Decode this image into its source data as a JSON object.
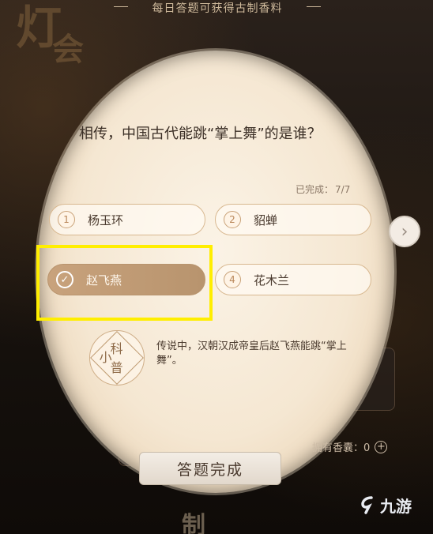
{
  "banner": "每日答题可获得古制香料",
  "bg_glyphs": {
    "left_big": "灯",
    "left_small": "会",
    "bottom": "制"
  },
  "question": "相传，中国古代能跳“掌上舞”的是谁？",
  "progress": {
    "label": "已完成：",
    "value": "7/7"
  },
  "options": [
    {
      "num": "1",
      "text": "杨玉环",
      "selected": false
    },
    {
      "num": "2",
      "text": "貂蝉",
      "selected": false
    },
    {
      "num": "✓",
      "text": "赵飞燕",
      "selected": true
    },
    {
      "num": "4",
      "text": "花木兰",
      "selected": false
    }
  ],
  "science_seal": {
    "top": "科",
    "left": "小",
    "bottom": "普"
  },
  "explanation": "传说中，汉朝汉成帝皇后赵飞燕能跳“掌上舞”。",
  "sachet": {
    "label": "拥有香囊：0"
  },
  "done_button": "答题完成",
  "watermark": "九游",
  "colors": {
    "accent": "#b8946e",
    "highlight": "#ffee00",
    "text": "#4a3a2e"
  }
}
